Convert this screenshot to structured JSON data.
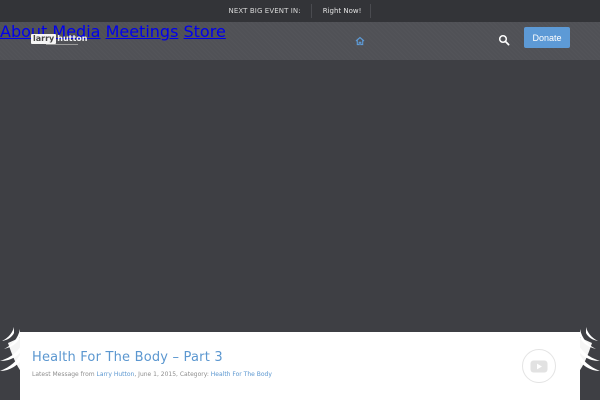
{
  "event_bar": {
    "label": "NEXT BIG EVENT IN:",
    "value": "Right Now!"
  },
  "logo": {
    "box": "larry",
    "rest": "hutton"
  },
  "nav": {
    "items": [
      {
        "label": "About"
      },
      {
        "label": "Media"
      },
      {
        "label": "Meetings"
      },
      {
        "label": "Store"
      }
    ],
    "donate_label": "Donate"
  },
  "message": {
    "title": "Health For The Body – Part 3",
    "meta_prefix": "Latest Message from",
    "author": "Larry Hutton",
    "date_text": ", June 1, 2015, Category:",
    "category": "Health For The Body"
  },
  "colors": {
    "accent": "#5d9ad6",
    "background": "#3e3f44",
    "header": "#505156",
    "topbar": "#333438"
  }
}
